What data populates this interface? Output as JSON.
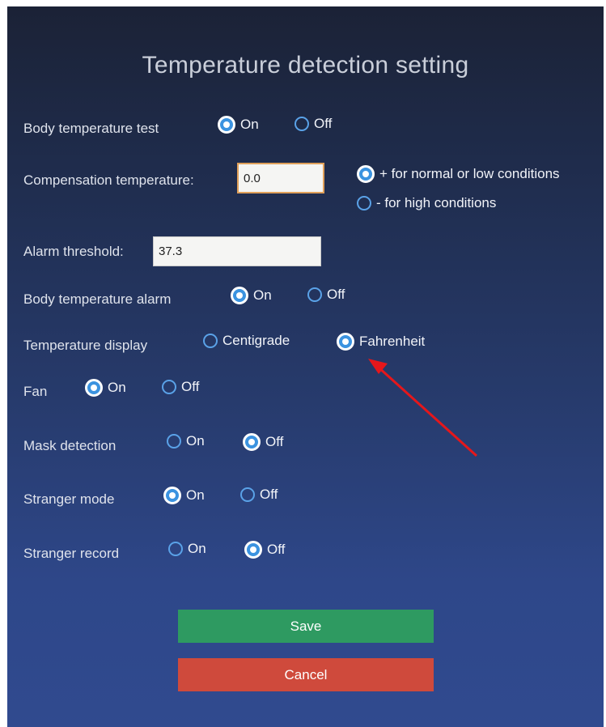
{
  "title": "Temperature detection setting",
  "accent_color": "#3b93e0",
  "rows": {
    "body_temp_test": {
      "label": "Body temperature test",
      "on": "On",
      "off": "Off",
      "selected": "On"
    },
    "compensation": {
      "label": "Compensation temperature:",
      "value": "0.0",
      "plus_option": "+ for normal or low conditions",
      "minus_option": "- for high conditions",
      "selected": "+"
    },
    "alarm_threshold": {
      "label": "Alarm threshold:",
      "value": "37.3"
    },
    "body_temp_alarm": {
      "label": "Body temperature alarm",
      "on": "On",
      "off": "Off",
      "selected": "On"
    },
    "temp_display": {
      "label": "Temperature display",
      "centigrade": "Centigrade",
      "fahrenheit": "Fahrenheit",
      "selected": "Fahrenheit"
    },
    "fan": {
      "label": "Fan",
      "on": "On",
      "off": "Off",
      "selected": "On"
    },
    "mask_detection": {
      "label": "Mask detection",
      "on": "On",
      "off": "Off",
      "selected": "Off"
    },
    "stranger_mode": {
      "label": "Stranger mode",
      "on": "On",
      "off": "Off",
      "selected": "On"
    },
    "stranger_record": {
      "label": "Stranger record",
      "on": "On",
      "off": "Off",
      "selected": "Off"
    }
  },
  "buttons": {
    "save": "Save",
    "cancel": "Cancel",
    "save_color": "#2e9a61",
    "cancel_color": "#cf4a3c"
  },
  "annotation": {
    "arrow_color": "#e5171b",
    "points_to": "Fahrenheit"
  }
}
